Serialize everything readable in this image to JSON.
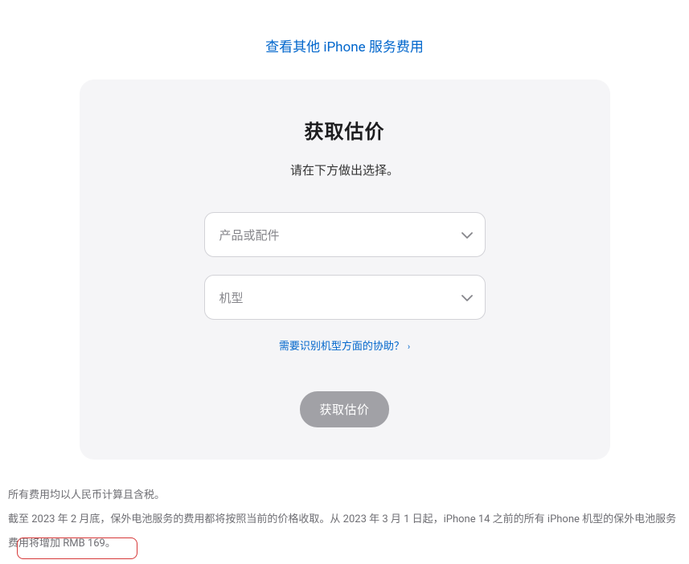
{
  "toplink": {
    "label": "查看其他 iPhone 服务费用"
  },
  "card": {
    "title": "获取估价",
    "subtitle": "请在下方做出选择。",
    "select1": {
      "placeholder": "产品或配件"
    },
    "select2": {
      "placeholder": "机型"
    },
    "help": {
      "label": "需要识别机型方面的协助？"
    },
    "submit": {
      "label": "获取估价"
    }
  },
  "footer": {
    "line1": "所有费用均以人民币计算且含税。",
    "line2": "截至 2023 年 2 月底，保外电池服务的费用都将按照当前的价格收取。从 2023 年 3 月 1 日起，iPhone 14 之前的所有 iPhone 机型的保外电池服务费用将增加 RMB 169。"
  }
}
